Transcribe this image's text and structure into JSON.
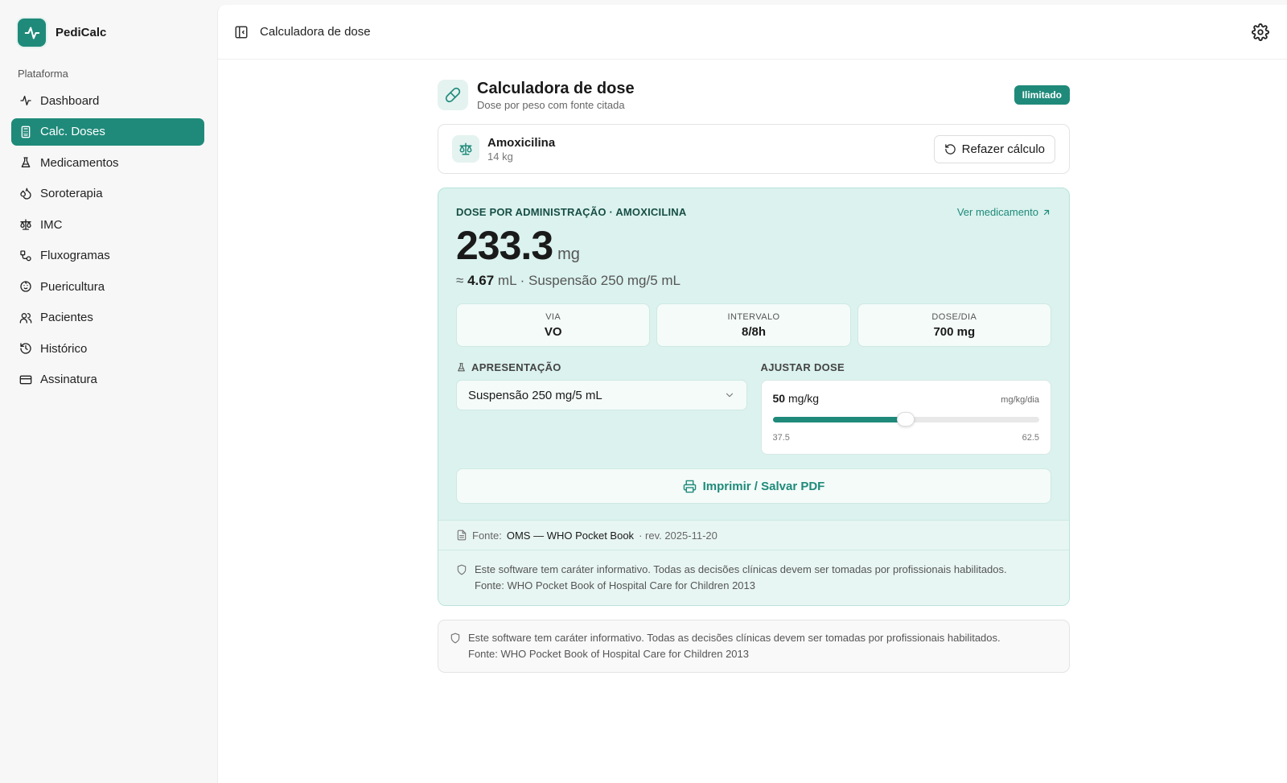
{
  "app": {
    "name": "PediCalc"
  },
  "sidebar": {
    "section": "Plataforma",
    "items": [
      {
        "label": "Dashboard"
      },
      {
        "label": "Calc. Doses"
      },
      {
        "label": "Medicamentos"
      },
      {
        "label": "Soroterapia"
      },
      {
        "label": "IMC"
      },
      {
        "label": "Fluxogramas"
      },
      {
        "label": "Puericultura"
      },
      {
        "label": "Pacientes"
      },
      {
        "label": "Histórico"
      },
      {
        "label": "Assinatura"
      }
    ],
    "active_index": 1
  },
  "topbar": {
    "breadcrumb": "Calculadora de dose"
  },
  "page": {
    "title": "Calculadora de dose",
    "subtitle": "Dose por peso com fonte citada",
    "badge": "Ilimitado"
  },
  "drug": {
    "name": "Amoxicilina",
    "weight": "14 kg",
    "redo_label": "Refazer cálculo"
  },
  "result": {
    "label": "DOSE POR ADMINISTRAÇÃO · AMOXICILINA",
    "link": "Ver medicamento",
    "dose_value": "233.3",
    "dose_unit": "mg",
    "approx_prefix": "≈",
    "approx_value": "4.67",
    "approx_rest": "mL · Suspensão 250 mg/5 mL",
    "stats": [
      {
        "key": "VIA",
        "value": "VO"
      },
      {
        "key": "INTERVALO",
        "value": "8/8h"
      },
      {
        "key": "DOSE/DIA",
        "value": "700 mg"
      }
    ],
    "presentation_label": "APRESENTAÇÃO",
    "presentation_value": "Suspensão 250 mg/5 mL",
    "adjust_label": "AJUSTAR DOSE",
    "adjust_value": "50",
    "adjust_unit": "mg/kg",
    "adjust_unit_right": "mg/kg/dia",
    "slider_min": "37.5",
    "slider_max": "62.5",
    "slider_current": 50,
    "print_label": "Imprimir / Salvar PDF"
  },
  "source": {
    "prefix": "Fonte:",
    "name": "OMS — WHO Pocket Book",
    "rev": "· rev. 2025-11-20"
  },
  "disclaimer": {
    "line1": "Este software tem caráter informativo. Todas as decisões clínicas devem ser tomadas por profissionais habilitados.",
    "line2": "Fonte: WHO Pocket Book of Hospital Care for Children 2013"
  },
  "colors": {
    "accent": "#1f8a7a",
    "result_bg": "#dbf2ee"
  }
}
